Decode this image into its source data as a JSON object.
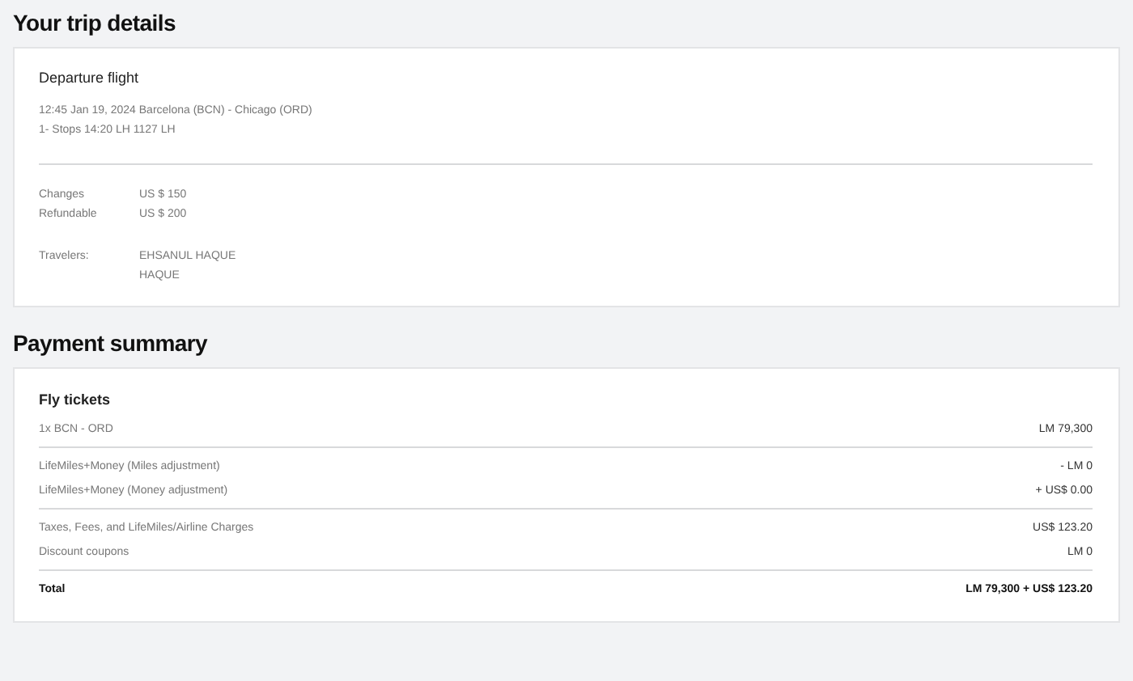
{
  "trip": {
    "heading": "Your trip details",
    "flight": {
      "title": "Departure flight",
      "lines": [
        "12:45 Jan 19, 2024 Barcelona (BCN) - Chicago (ORD)",
        "1- Stops 14:20 LH 1127 LH"
      ]
    },
    "policies": [
      {
        "label": "Changes",
        "value": "US $ 150"
      },
      {
        "label": "Refundable",
        "value": "US $ 200"
      }
    ],
    "travelers": {
      "label": "Travelers:",
      "names": [
        "EHSANUL HAQUE",
        "HAQUE"
      ]
    }
  },
  "payment": {
    "heading": "Payment summary",
    "title": "Fly tickets",
    "groups": [
      {
        "rows": [
          {
            "kind": "item",
            "label": "1x BCN - ORD",
            "value": "LM 79,300"
          }
        ]
      },
      {
        "rows": [
          {
            "kind": "item",
            "label": "LifeMiles+Money (Miles adjustment)",
            "value": "- LM 0"
          },
          {
            "kind": "item",
            "label": "LifeMiles+Money (Money adjustment)",
            "value": "+ US$ 0.00"
          }
        ]
      },
      {
        "rows": [
          {
            "kind": "item",
            "label": "Taxes, Fees, and LifeMiles/Airline Charges",
            "value": "US$ 123.20"
          },
          {
            "kind": "item",
            "label": "Discount coupons",
            "value": "LM 0"
          }
        ]
      },
      {
        "rows": [
          {
            "kind": "total",
            "label": "Total",
            "value": "LM 79,300 + US$ 123.20"
          }
        ]
      }
    ]
  }
}
